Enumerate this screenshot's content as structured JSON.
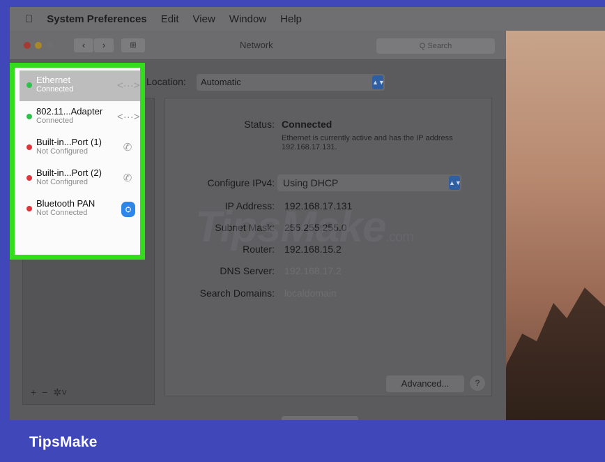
{
  "menubar": {
    "app_name": "System Preferences",
    "items": [
      "Edit",
      "View",
      "Window",
      "Help"
    ]
  },
  "window": {
    "title": "Network",
    "search_placeholder": "Q Search",
    "grid_icon": "⊞",
    "back_icon": "‹",
    "forward_icon": "›"
  },
  "location": {
    "label": "Location:",
    "value": "Automatic"
  },
  "services": [
    {
      "name": "Ethernet",
      "status": "Connected",
      "status_color": "green",
      "icon": "ethernet-arrows",
      "selected": true
    },
    {
      "name": "802.11...Adapter",
      "status": "Connected",
      "status_color": "green",
      "icon": "ethernet-arrows",
      "selected": false
    },
    {
      "name": "Built-in...Port (1)",
      "status": "Not Configured",
      "status_color": "red",
      "icon": "phone",
      "selected": false
    },
    {
      "name": "Built-in...Port (2)",
      "status": "Not Configured",
      "status_color": "red",
      "icon": "phone",
      "selected": false
    },
    {
      "name": "Bluetooth PAN",
      "status": "Not Connected",
      "status_color": "red",
      "icon": "bluetooth",
      "selected": false
    }
  ],
  "list_tools": {
    "add": "+",
    "remove": "−",
    "gear": "✲˅"
  },
  "detail": {
    "status_label": "Status:",
    "status_value": "Connected",
    "status_desc": "Ethernet is currently active and has the IP address 192.168.17.131.",
    "configure_label": "Configure IPv4:",
    "configure_value": "Using DHCP",
    "ip_label": "IP Address:",
    "ip_value": "192.168.17.131",
    "subnet_label": "Subnet Mask:",
    "subnet_value": "255.255.255.0",
    "router_label": "Router:",
    "router_value": "192.168.15.2",
    "dns_label": "DNS Server:",
    "dns_value": "192.168.17.2",
    "search_domains_label": "Search Domains:",
    "search_domains_value": "localdomain",
    "advanced_label": "Advanced...",
    "help_label": "?"
  },
  "watermark": {
    "main": "TipsMake",
    "suffix": ".com"
  },
  "brand": "TipsMake",
  "colors": {
    "frame": "#4047b8",
    "highlight": "#33dd1c",
    "status_green": "#2fc24c",
    "status_red": "#e0353c",
    "bluetooth": "#2d86e8"
  }
}
